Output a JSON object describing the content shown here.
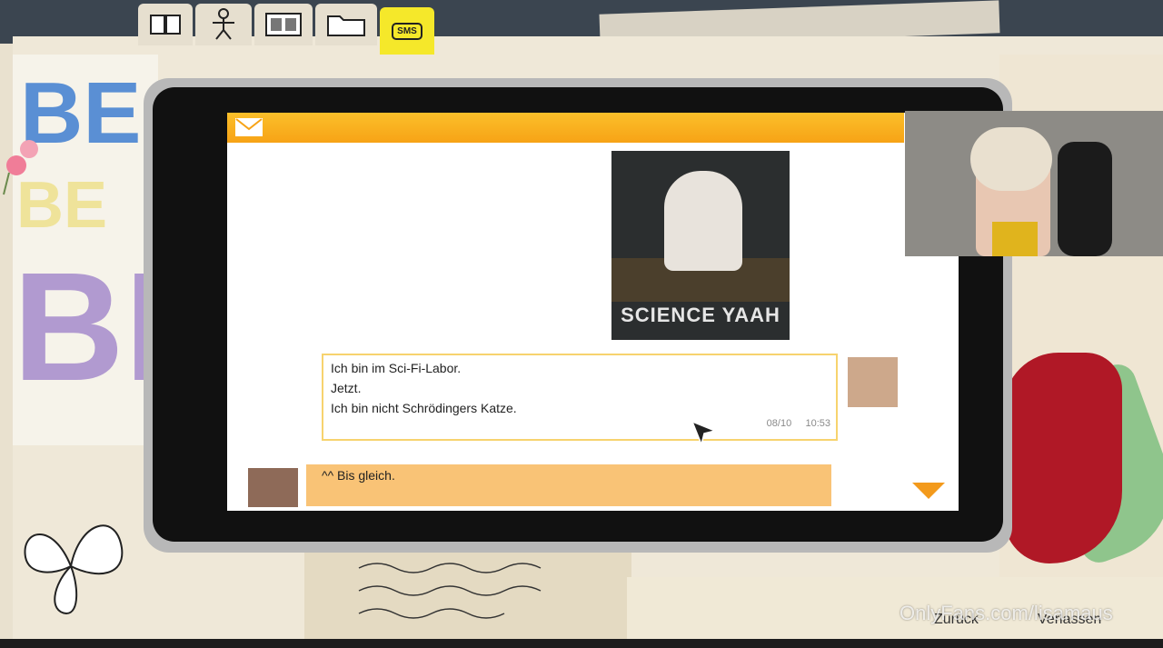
{
  "top_tabs": {
    "journal_icon": "journal-icon",
    "people_icon": "stick-figure-icon",
    "photos_icon": "photo-album-icon",
    "folder_icon": "folder-icon",
    "sms_label": "SMS"
  },
  "phone": {
    "header_icon": "envelope-icon",
    "image_caption": "SCIENCE YAAH",
    "message": {
      "line1": "Ich bin im Sci-Fi-Labor.",
      "line2": "Jetzt.",
      "line3": "Ich bin nicht Schrödingers Katze.",
      "date": "08/10",
      "time": "10:53"
    },
    "reply": {
      "text": "^^ Bis gleich."
    },
    "colors": {
      "header": "#f7a316",
      "reply_bg": "#f9c376",
      "arrow": "#f39a1c"
    }
  },
  "background": {
    "letters_top": "BE",
    "letters_mid": "BE",
    "letters_big": "BI"
  },
  "navigation": {
    "back_label": "Zurück",
    "leave_label": "Verlassen"
  },
  "watermark": "OnlyFans.com/lisamaus"
}
